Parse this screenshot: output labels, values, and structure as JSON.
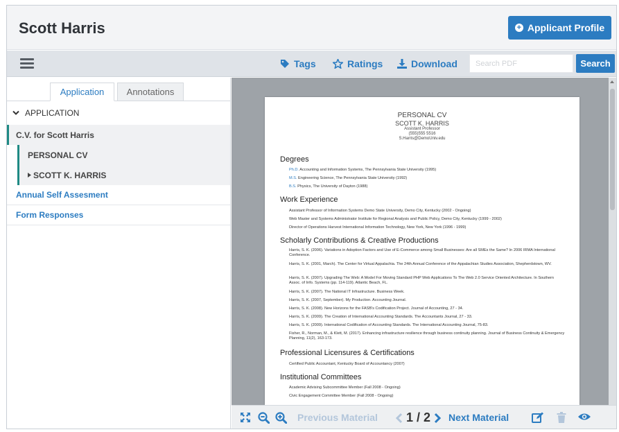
{
  "header": {
    "applicant_name": "Scott Harris",
    "profile_button_label": "Applicant Profile"
  },
  "toolbar": {
    "tags_label": "Tags",
    "ratings_label": "Ratings",
    "download_label": "Download",
    "search_placeholder": "Search PDF",
    "search_button_label": "Search"
  },
  "sidebar": {
    "tabs": [
      {
        "label": "Application",
        "active": true
      },
      {
        "label": "Annotations",
        "active": false
      }
    ],
    "section_label": "APPLICATION",
    "items": {
      "cv": "C.V. for Scott Harris",
      "personal_cv": "PERSONAL CV",
      "scott_k_harris": "SCOTT K. HARRIS",
      "annual": "Annual Self Assesment",
      "form_responses": "Form Responses"
    }
  },
  "document": {
    "title": "PERSONAL CV",
    "name": "SCOTT K. HARRIS",
    "role": "Assistant Professor",
    "phone": "(555)555 5516",
    "email": "S.Harris@DemoUniv.edu",
    "sections": {
      "degrees": "Degrees",
      "work": "Work Experience",
      "scholarly": "Scholarly Contributions & Creative Productions",
      "licensures": "Professional Licensures & Certifications",
      "committees": "Institutional Committees"
    },
    "degrees": [
      {
        "deg": "Ph.D.",
        "text": " Accounting and Information Systems, The Pennsylvania State University (1995)"
      },
      {
        "deg": "M.S.",
        "text": " Engineering Science, The Pennsylvania State University (1992)"
      },
      {
        "deg": "B.S.",
        "text": " Physics, The University of Dayton (1988)"
      }
    ],
    "work": [
      "Assistant Professor of Information Systems Demo State University, Demo City, Kentucky (2002 - Ongoing)",
      "Web Master and Systems Administrator Institute for Regional Analysis and Public Policy, Demo City, Kentucky (1999 - 2002)",
      "Director of Operations Harvest International Information Technology, New York, New York (1996 - 1999)"
    ],
    "scholarly": [
      "Harris, S. K. (2006). Variations in Adoption Factors and Use of E-Commerce among Small Businesses: Are all SMEs the Same? In 2006 IRMA International Conference.",
      "Harris, S. K. (2001, March). The Center for Virtual Appalachia. The 24th Annual Conference of the Appalachian Studies Association, Shepherdstown, WV.",
      "Harris, S. K. (2007). Upgrading The Web: A Model For Moving Standard PHP Web Applications To The Web 2.0 Service Oriented Architecture. In Southern Assoc. of Info. Systems (pp. 114-119). Atlantic Beach, FL.",
      "Harris, S. K. (2007). The National IT Infrastructure. Business Week.",
      "Harris, S. K. (2007, September). My Production. Accounting Journal.",
      "Harris, S. K. (2008). New Horizons for the FASB's Codification Project. Journal of Accounting, 27 - 34.",
      "Harris, S. K. (2009). The Creation of International Accounting Standards. The Accountants Journal, 27 - 33.",
      "Harris, S. K. (2009). International Codification of Accounting Standards. The International Accounting Journal, 75-83.",
      "Fisher, R., Norman, M., & Klett, M. (2017). Enhancing infrastructure resilience through business continuity planning. Journal of Business Continuity & Emergency Planning, 11(2), 163-173."
    ],
    "licensures": [
      "Certified Public Accountant, Kentucky Board of Accountancy (2007)"
    ],
    "committees": [
      "Academic Advising Subcommittee Member (Fall 2008 - Ongoing)",
      "Civic Engagement Committee Member (Fall 2008 - Ongoing)"
    ]
  },
  "viewer_controls": {
    "previous_label": "Previous Material",
    "page_indicator": "1 / 2",
    "next_label": "Next Material"
  },
  "colors": {
    "accent": "#2c7cc1",
    "nav_indicator": "#1f8a84",
    "viewer_bg": "#9ea3a8"
  },
  "icons": [
    "plus-circle-icon",
    "menu-icon",
    "tag-icon",
    "star-icon",
    "download-icon",
    "chevron-down-icon",
    "caret-right-icon",
    "expand-icon",
    "zoom-out-icon",
    "zoom-in-icon",
    "chevron-left-icon",
    "chevron-right-icon",
    "edit-icon",
    "trash-icon",
    "eye-icon"
  ]
}
